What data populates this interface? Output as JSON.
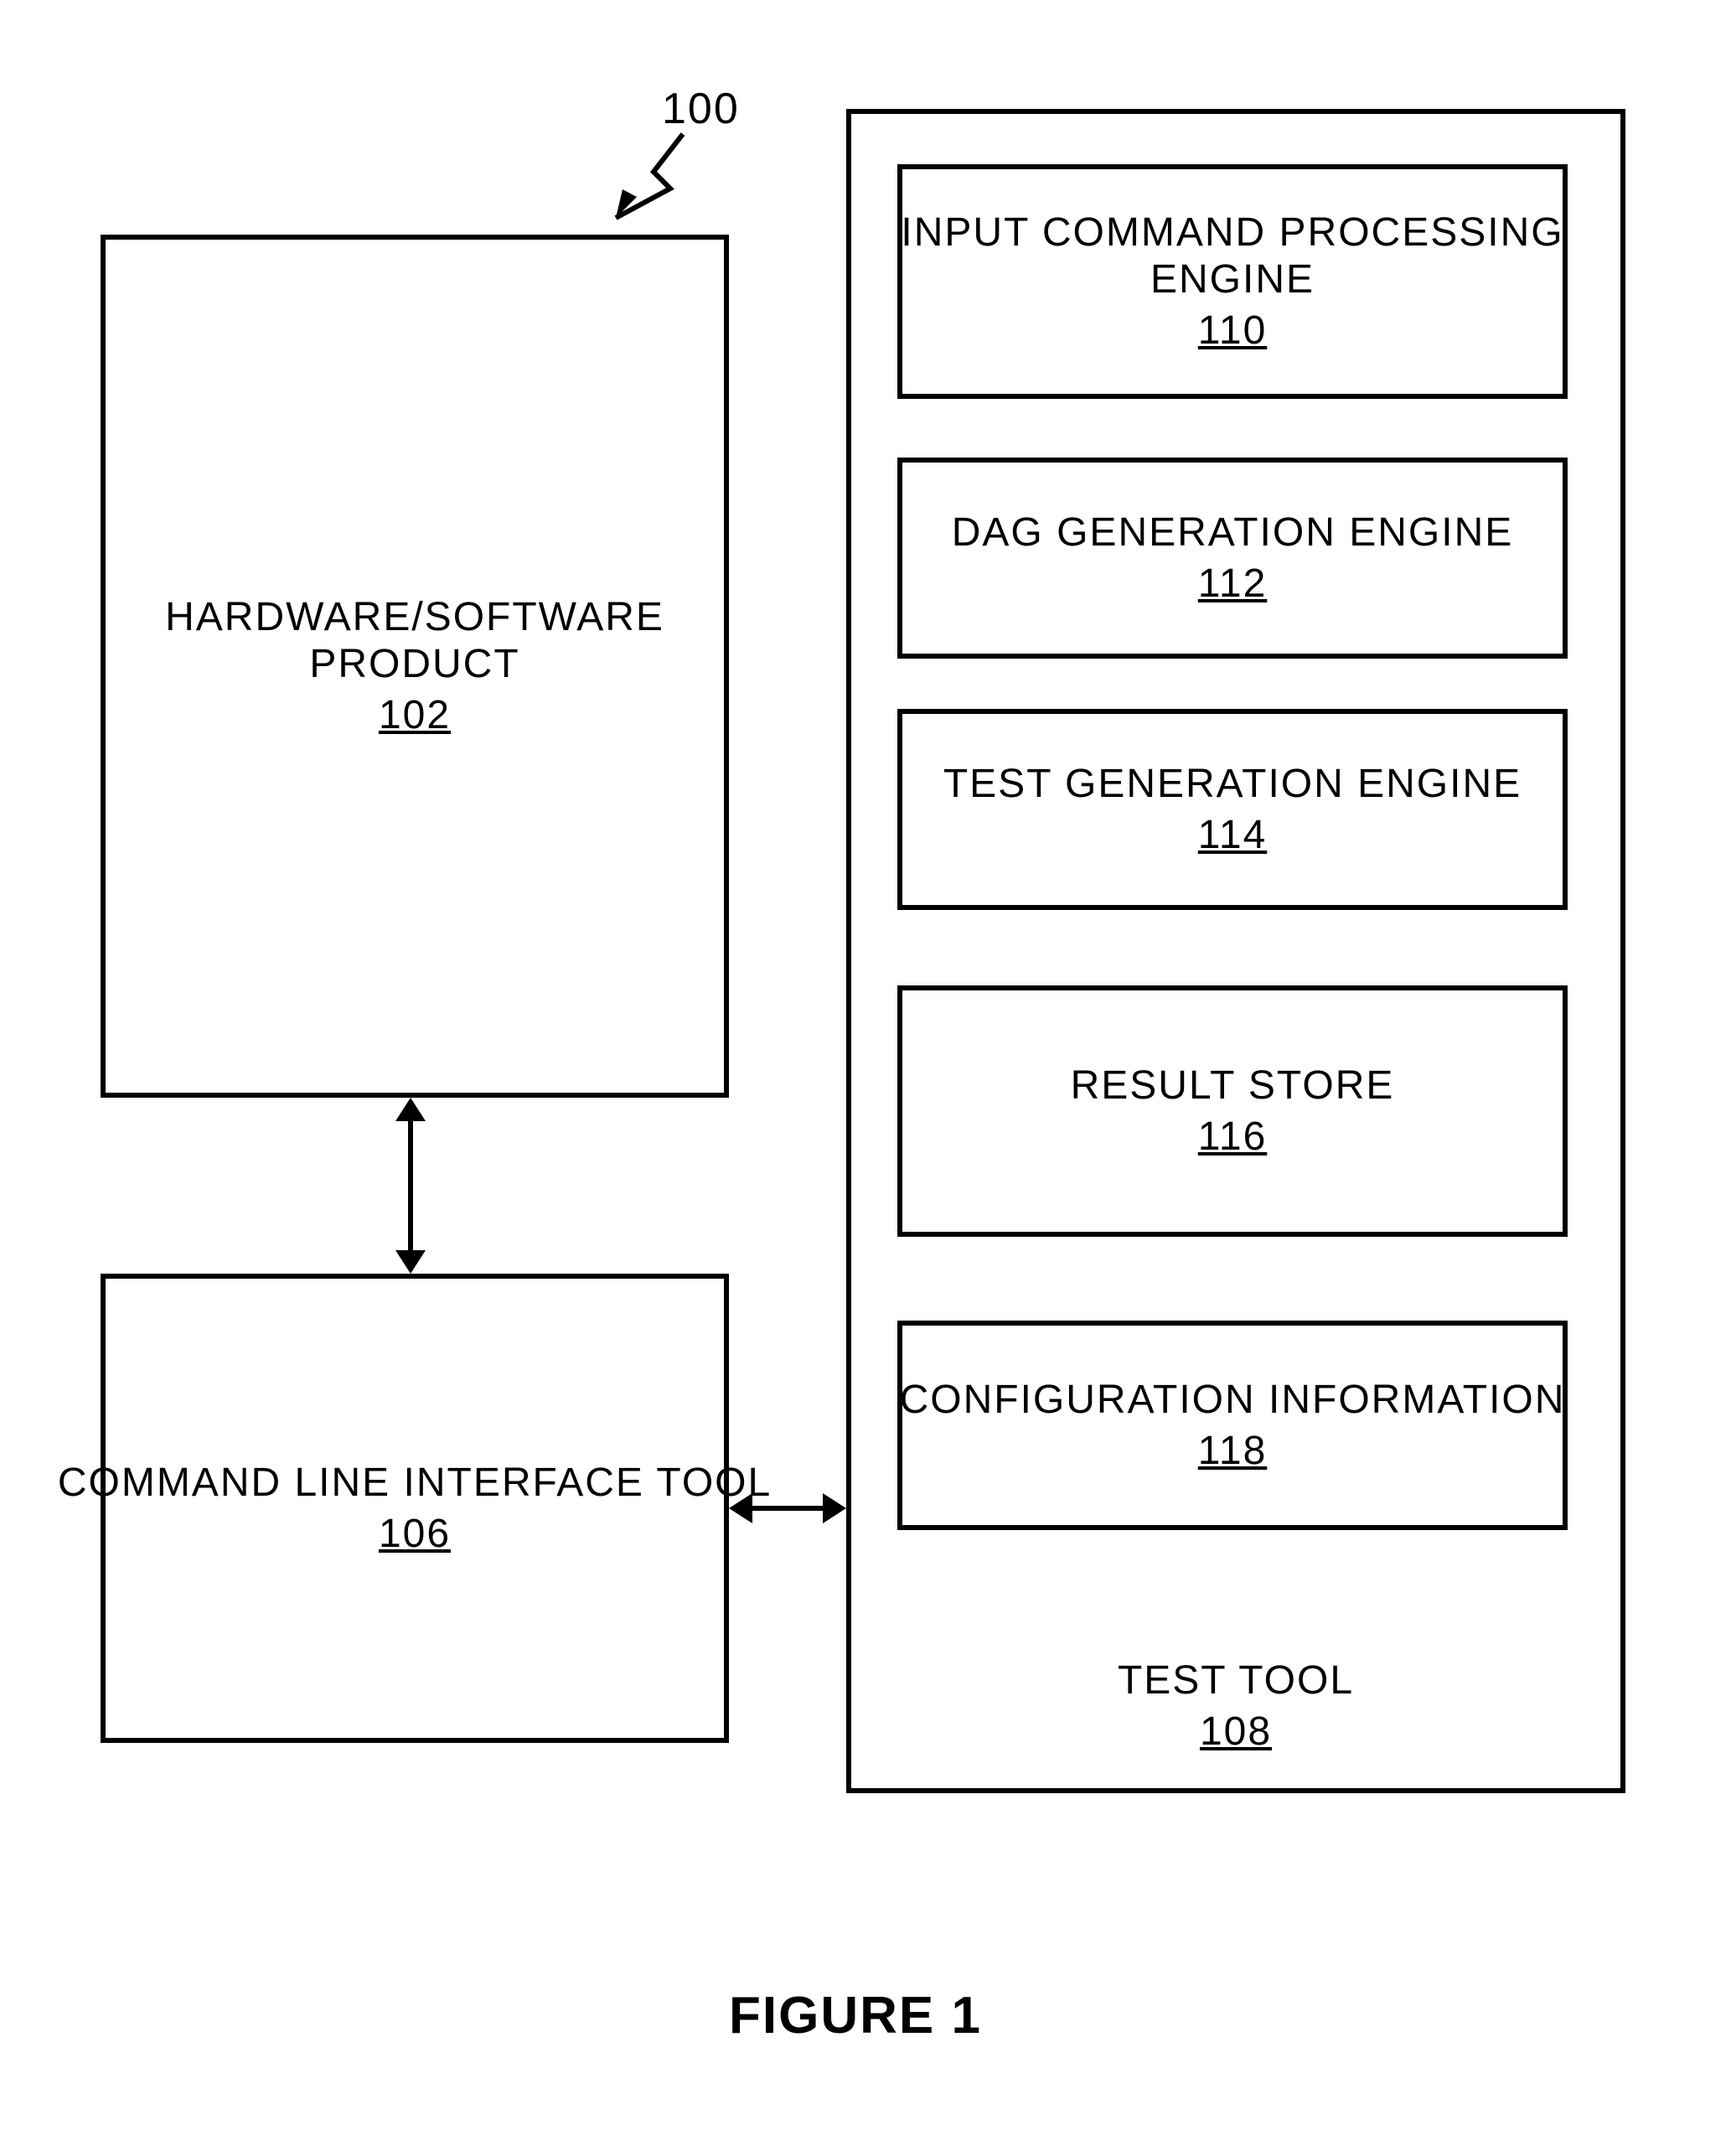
{
  "system_ref": "100",
  "figure_caption": "FIGURE 1",
  "left": {
    "product": {
      "line1": "HARDWARE/SOFTWARE",
      "line2": "PRODUCT",
      "ref": "102"
    },
    "cli": {
      "line1": "COMMAND LINE INTERFACE TOOL",
      "ref": "106"
    }
  },
  "test_tool": {
    "label": "TEST TOOL",
    "ref": "108",
    "items": [
      {
        "line1": "INPUT COMMAND PROCESSING",
        "line2": "ENGINE",
        "ref": "110"
      },
      {
        "line1": "DAG GENERATION ENGINE",
        "ref": "112"
      },
      {
        "line1": "TEST GENERATION ENGINE",
        "ref": "114"
      },
      {
        "line1": "RESULT STORE",
        "ref": "116"
      },
      {
        "line1": "CONFIGURATION INFORMATION",
        "ref": "118"
      }
    ]
  }
}
